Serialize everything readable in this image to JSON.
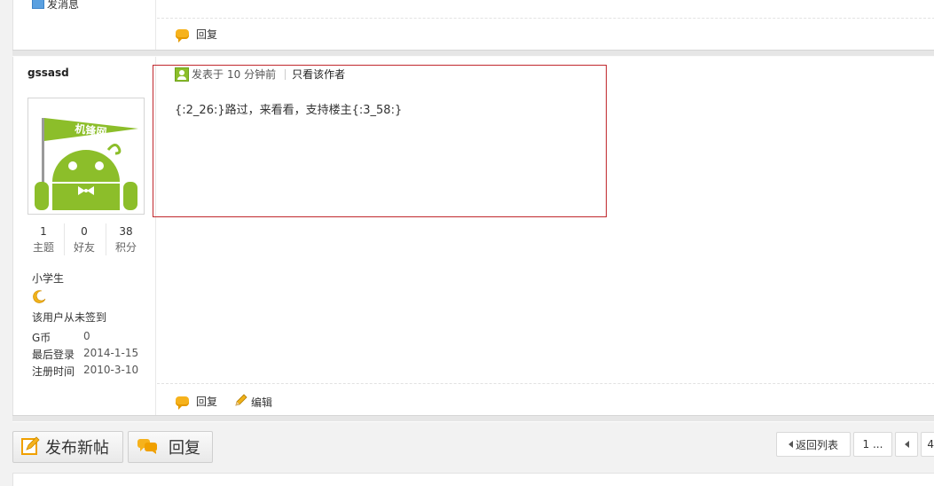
{
  "prev_post": {
    "send_message": "发消息",
    "reply_label": "回复"
  },
  "post": {
    "author": "gssasd",
    "avatar_logo_text": "机锋网",
    "stats": [
      {
        "value": "1",
        "label": "主题"
      },
      {
        "value": "0",
        "label": "好友"
      },
      {
        "value": "38",
        "label": "积分"
      }
    ],
    "rank": "小学生",
    "sign_status": "该用户从未签到",
    "info": [
      {
        "label": "G币",
        "value": "0"
      },
      {
        "label": "最后登录",
        "value": "2014-1-15"
      },
      {
        "label": "注册时间",
        "value": "2010-3-10"
      }
    ],
    "posted_prefix": "发表于",
    "posted_time": "10 分钟前",
    "only_author": "只看该作者",
    "content": "{:2_26:}路过，来看看，支持楼主{:3_58:}",
    "reply_label": "回复",
    "edit_label": "编辑"
  },
  "bottom": {
    "new_post": "发布新帖",
    "reply": "回复",
    "back_to_list": "返回列表",
    "page_first": "1 ...",
    "page_partial": "4"
  },
  "colors": {
    "highlight_border": "#c0282d",
    "reply_icon": "#f6b21c",
    "android_green": "#8cbe2a"
  }
}
